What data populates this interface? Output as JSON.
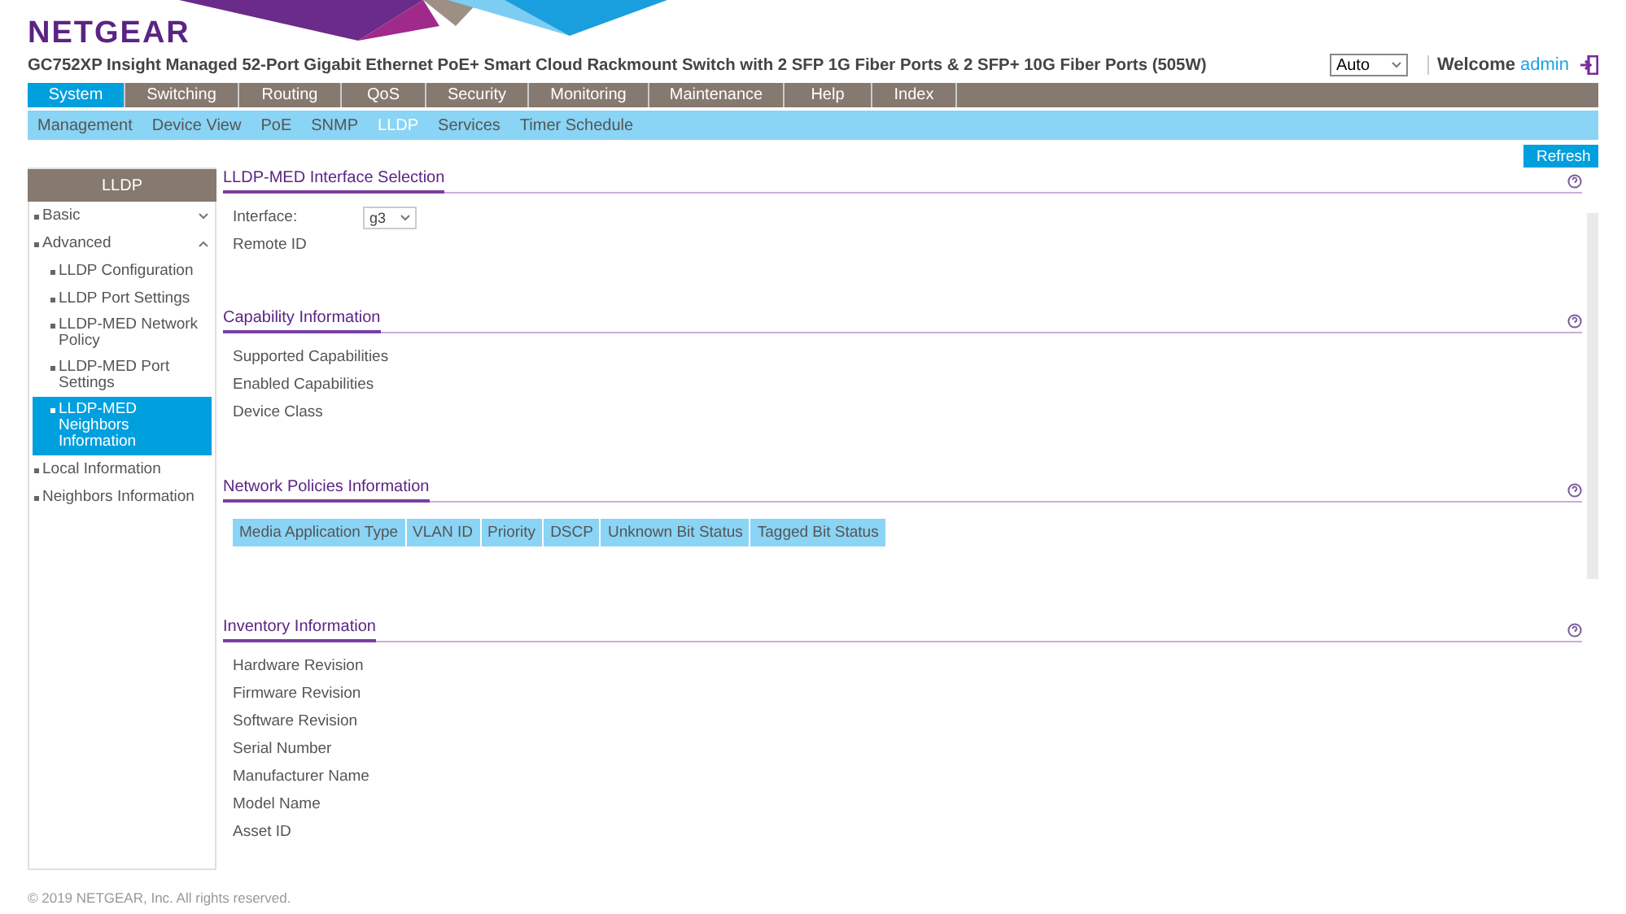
{
  "header": {
    "logo": "NETGEAR",
    "title": "GC752XP Insight Managed 52-Port Gigabit Ethernet PoE+ Smart Cloud Rackmount Switch with 2 SFP 1G Fiber Ports & 2 SFP+ 10G Fiber Ports (505W)",
    "language": "Auto",
    "welcome": "Welcome",
    "user": "admin"
  },
  "main_tabs": [
    {
      "label": "System",
      "selected": true
    },
    {
      "label": "Switching",
      "selected": false
    },
    {
      "label": "Routing",
      "selected": false
    },
    {
      "label": "QoS",
      "selected": false
    },
    {
      "label": "Security",
      "selected": false
    },
    {
      "label": "Monitoring",
      "selected": false
    },
    {
      "label": "Maintenance",
      "selected": false
    },
    {
      "label": "Help",
      "selected": false
    },
    {
      "label": "Index",
      "selected": false
    }
  ],
  "sub_tabs": [
    {
      "label": "Management",
      "selected": false
    },
    {
      "label": "Device View",
      "selected": false
    },
    {
      "label": "PoE",
      "selected": false
    },
    {
      "label": "SNMP",
      "selected": false
    },
    {
      "label": "LLDP",
      "selected": true
    },
    {
      "label": "Services",
      "selected": false
    },
    {
      "label": "Timer Schedule",
      "selected": false
    }
  ],
  "refresh_button": "Refresh",
  "sidebar": {
    "title": "LLDP",
    "items": [
      {
        "label": "Basic",
        "expanded": false
      },
      {
        "label": "Advanced",
        "expanded": true,
        "children": [
          {
            "label": "LLDP Configuration",
            "selected": false
          },
          {
            "label": "LLDP Port Settings",
            "selected": false
          },
          {
            "label": "LLDP-MED Network Policy",
            "selected": false
          },
          {
            "label": "LLDP-MED Port Settings",
            "selected": false
          },
          {
            "label": "LLDP-MED Neighbors Information",
            "selected": true
          }
        ]
      },
      {
        "label": "Local Information"
      },
      {
        "label": "Neighbors Information"
      }
    ]
  },
  "sections": [
    {
      "title": "LLDP-MED Interface Selection",
      "kind": "fields",
      "fields": [
        {
          "label": "Interface:",
          "kind": "select",
          "value": "g3"
        },
        {
          "label": "Remote ID",
          "kind": "label"
        }
      ]
    },
    {
      "title": "Capability Information",
      "kind": "fields",
      "fields": [
        {
          "label": "Supported Capabilities",
          "kind": "label"
        },
        {
          "label": "Enabled Capabilities",
          "kind": "label"
        },
        {
          "label": "Device Class",
          "kind": "label"
        }
      ]
    },
    {
      "title": "Network Policies Information",
      "kind": "table",
      "columns": [
        "Media Application Type",
        "VLAN ID",
        "Priority",
        "DSCP",
        "Unknown Bit Status",
        "Tagged Bit Status"
      ]
    },
    {
      "title": "Inventory Information",
      "kind": "fields",
      "fields": [
        {
          "label": "Hardware Revision",
          "kind": "label"
        },
        {
          "label": "Firmware Revision",
          "kind": "label"
        },
        {
          "label": "Software Revision",
          "kind": "label"
        },
        {
          "label": "Serial Number",
          "kind": "label"
        },
        {
          "label": "Manufacturer Name",
          "kind": "label"
        },
        {
          "label": "Model Name",
          "kind": "label"
        },
        {
          "label": "Asset ID",
          "kind": "label"
        }
      ]
    }
  ],
  "footer": "© 2019 NETGEAR, Inc. All rights reserved."
}
